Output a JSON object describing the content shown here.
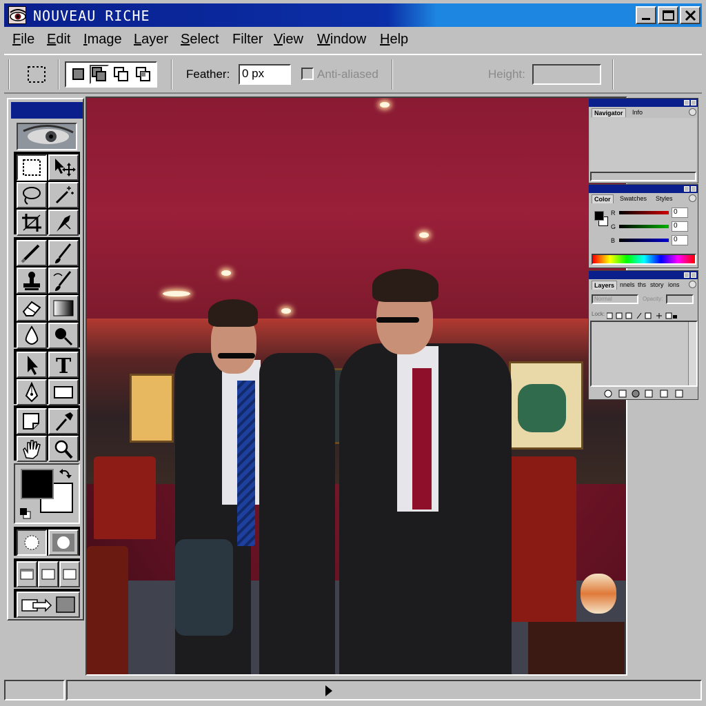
{
  "app": {
    "title": "NOUVEAU RICHE"
  },
  "window_controls": {
    "minimize_icon": "minimize-icon",
    "maximize_icon": "maximize-icon",
    "close_icon": "close-icon"
  },
  "menu": [
    {
      "label": "File",
      "mnemonic": "F",
      "rest": "ile"
    },
    {
      "label": "Edit",
      "mnemonic": "E",
      "rest": "dit"
    },
    {
      "label": "Image",
      "mnemonic": "I",
      "rest": "mage"
    },
    {
      "label": "Layer",
      "mnemonic": "L",
      "rest": "ayer"
    },
    {
      "label": "Select",
      "mnemonic": "S",
      "rest": "elect"
    },
    {
      "label": "Filter",
      "mnemonic": "",
      "rest": "Filter"
    },
    {
      "label": "View",
      "mnemonic": "V",
      "rest": "iew"
    },
    {
      "label": "Window",
      "mnemonic": "W",
      "rest": "indow"
    },
    {
      "label": "Help",
      "mnemonic": "H",
      "rest": "elp"
    }
  ],
  "options": {
    "feather_label": "Feather:",
    "feather_value": "0 px",
    "antialias_label": "Anti-aliased",
    "height_label": "Height:",
    "height_value": ""
  },
  "navigator_palette": {
    "tabs": [
      "Navigator",
      "Info"
    ]
  },
  "color_palette": {
    "tabs": [
      "Color",
      "Swatches",
      "Styles"
    ],
    "channels": [
      {
        "name": "R",
        "value": "0",
        "color": "#d00000"
      },
      {
        "name": "G",
        "value": "0",
        "color": "#00a000"
      },
      {
        "name": "B",
        "value": "0",
        "color": "#0000d0"
      }
    ]
  },
  "layers_palette": {
    "tabs": [
      "Layers",
      "nnels",
      "ths",
      "story",
      "ions"
    ],
    "blend_mode": "Normal",
    "opacity_label": "Opacity:",
    "lock_label": "Lock:"
  },
  "colors": {
    "titlebar": "#0a1f8c",
    "chrome": "#c0c0c0",
    "foreground": "#000000",
    "background": "#ffffff"
  }
}
